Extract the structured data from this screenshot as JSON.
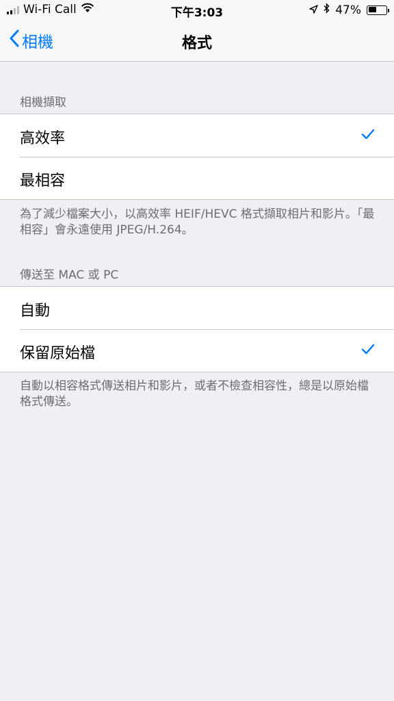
{
  "status_bar": {
    "carrier": "Wi-Fi Call",
    "time": "下午3:03",
    "battery_percent": "47%",
    "battery_level": 0.47,
    "icons": [
      "signal-icon",
      "wifi-icon",
      "location-icon",
      "bluetooth-icon",
      "battery-icon"
    ]
  },
  "nav": {
    "back_label": "相機",
    "title": "格式"
  },
  "sections": [
    {
      "header": "相機擷取",
      "items": [
        {
          "label": "高效率",
          "checked": true
        },
        {
          "label": "最相容",
          "checked": false
        }
      ],
      "footer": "為了減少檔案大小，以高效率 HEIF/HEVC 格式擷取相片和影片。「最相容」會永遠使用 JPEG/H.264。"
    },
    {
      "header": "傳送至 MAC 或 PC",
      "items": [
        {
          "label": "自動",
          "checked": false
        },
        {
          "label": "保留原始檔",
          "checked": true
        }
      ],
      "footer": "自動以相容格式傳送相片和影片，或者不檢查相容性，總是以原始檔格式傳送。"
    }
  ],
  "colors": {
    "accent": "#007aff",
    "background": "#efeff4",
    "secondary_text": "#6d6d72",
    "separator": "#c8c7cc"
  }
}
